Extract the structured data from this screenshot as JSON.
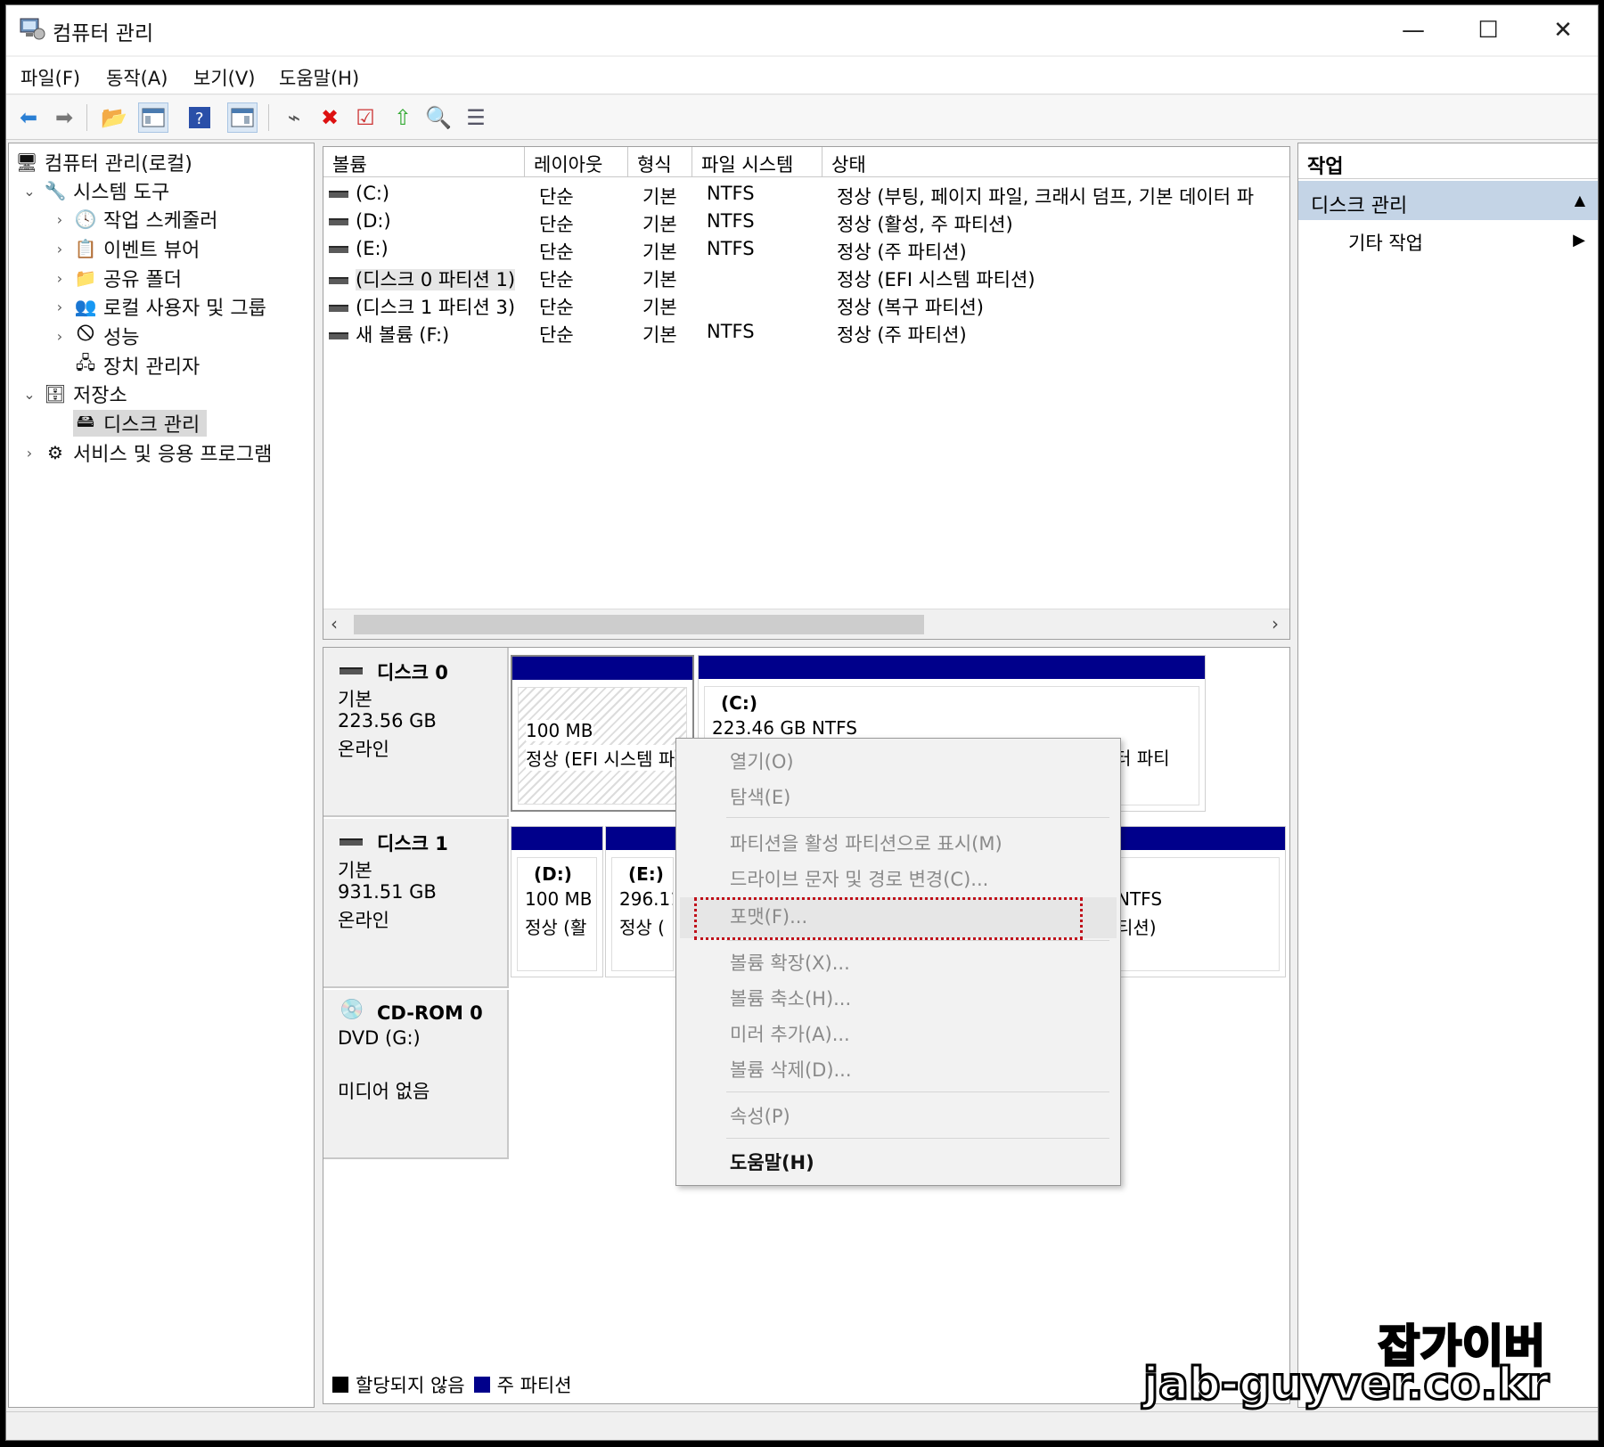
{
  "window": {
    "title": "컴퓨터 관리"
  },
  "menu": [
    "파일(F)",
    "동작(A)",
    "보기(V)",
    "도움말(H)"
  ],
  "tree": {
    "root": "컴퓨터 관리(로컬)",
    "system_tools": "시스템 도구",
    "task_scheduler": "작업 스케줄러",
    "event_viewer": "이벤트 뷰어",
    "shared_folders": "공유 폴더",
    "local_users": "로컬 사용자 및 그룹",
    "performance": "성능",
    "device_manager": "장치 관리자",
    "storage": "저장소",
    "disk_management": "디스크 관리",
    "services": "서비스 및 응용 프로그램"
  },
  "volume_list": {
    "columns": [
      "볼륨",
      "레이아웃",
      "형식",
      "파일 시스템",
      "상태"
    ],
    "rows": [
      {
        "volume": "(C:)",
        "layout": "단순",
        "type": "기본",
        "fs": "NTFS",
        "status": "정상 (부팅, 페이지 파일, 크래시 덤프, 기본 데이터 파"
      },
      {
        "volume": "(D:)",
        "layout": "단순",
        "type": "기본",
        "fs": "NTFS",
        "status": "정상 (활성, 주 파티션)"
      },
      {
        "volume": "(E:)",
        "layout": "단순",
        "type": "기본",
        "fs": "NTFS",
        "status": "정상 (주 파티션)"
      },
      {
        "volume": "(디스크 0 파티션 1)",
        "layout": "단순",
        "type": "기본",
        "fs": "",
        "status": "정상 (EFI 시스템 파티션)"
      },
      {
        "volume": "(디스크 1 파티션 3)",
        "layout": "단순",
        "type": "기본",
        "fs": "",
        "status": "정상 (복구 파티션)"
      },
      {
        "volume": "새 볼륨 (F:)",
        "layout": "단순",
        "type": "기본",
        "fs": "NTFS",
        "status": "정상 (주 파티션)"
      }
    ]
  },
  "disks": {
    "disk0": {
      "name": "디스크 0",
      "type": "기본",
      "size": "223.56 GB",
      "state": "온라인",
      "p1": {
        "size": "100 MB",
        "status": "정상 (EFI 시스템 파"
      },
      "p2": {
        "label": "(C:)",
        "size": "223.46 GB NTFS",
        "status_tail": "터 파티"
      }
    },
    "disk1": {
      "name": "디스크 1",
      "type": "기본",
      "size": "931.51 GB",
      "state": "온라인",
      "p1": {
        "label": "(D:)",
        "size": "100 MB",
        "status": "정상 (활"
      },
      "p2": {
        "label": "(E:)",
        "size": "296.11",
        "status": "정상 ("
      },
      "p3": {
        "size_tail": "NTFS",
        "status_tail": "티션)"
      }
    },
    "cdrom0": {
      "name": "CD-ROM 0",
      "type": "DVD (G:)",
      "state": "미디어 없음"
    }
  },
  "legend": {
    "unallocated": "할당되지 않음",
    "primary": "주 파티션"
  },
  "actions": {
    "title": "작업",
    "section": "디스크 관리",
    "more": "기타 작업"
  },
  "context_menu": {
    "open": "열기(O)",
    "explore": "탐색(E)",
    "mark_active": "파티션을 활성 파티션으로 표시(M)",
    "change_letter": "드라이브 문자 및 경로 변경(C)...",
    "format": "포맷(F)...",
    "extend": "볼륨 확장(X)...",
    "shrink": "볼륨 축소(H)...",
    "add_mirror": "미러 추가(A)...",
    "delete": "볼륨 삭제(D)...",
    "properties": "속성(P)",
    "help": "도움말(H)"
  },
  "watermark": {
    "line1": "잡가이버",
    "line2": "jab-guyver.co.kr"
  },
  "colors": {
    "primary_partition": "#00008b",
    "highlight": "#c0101a",
    "action_section": "#c4d4e6"
  }
}
